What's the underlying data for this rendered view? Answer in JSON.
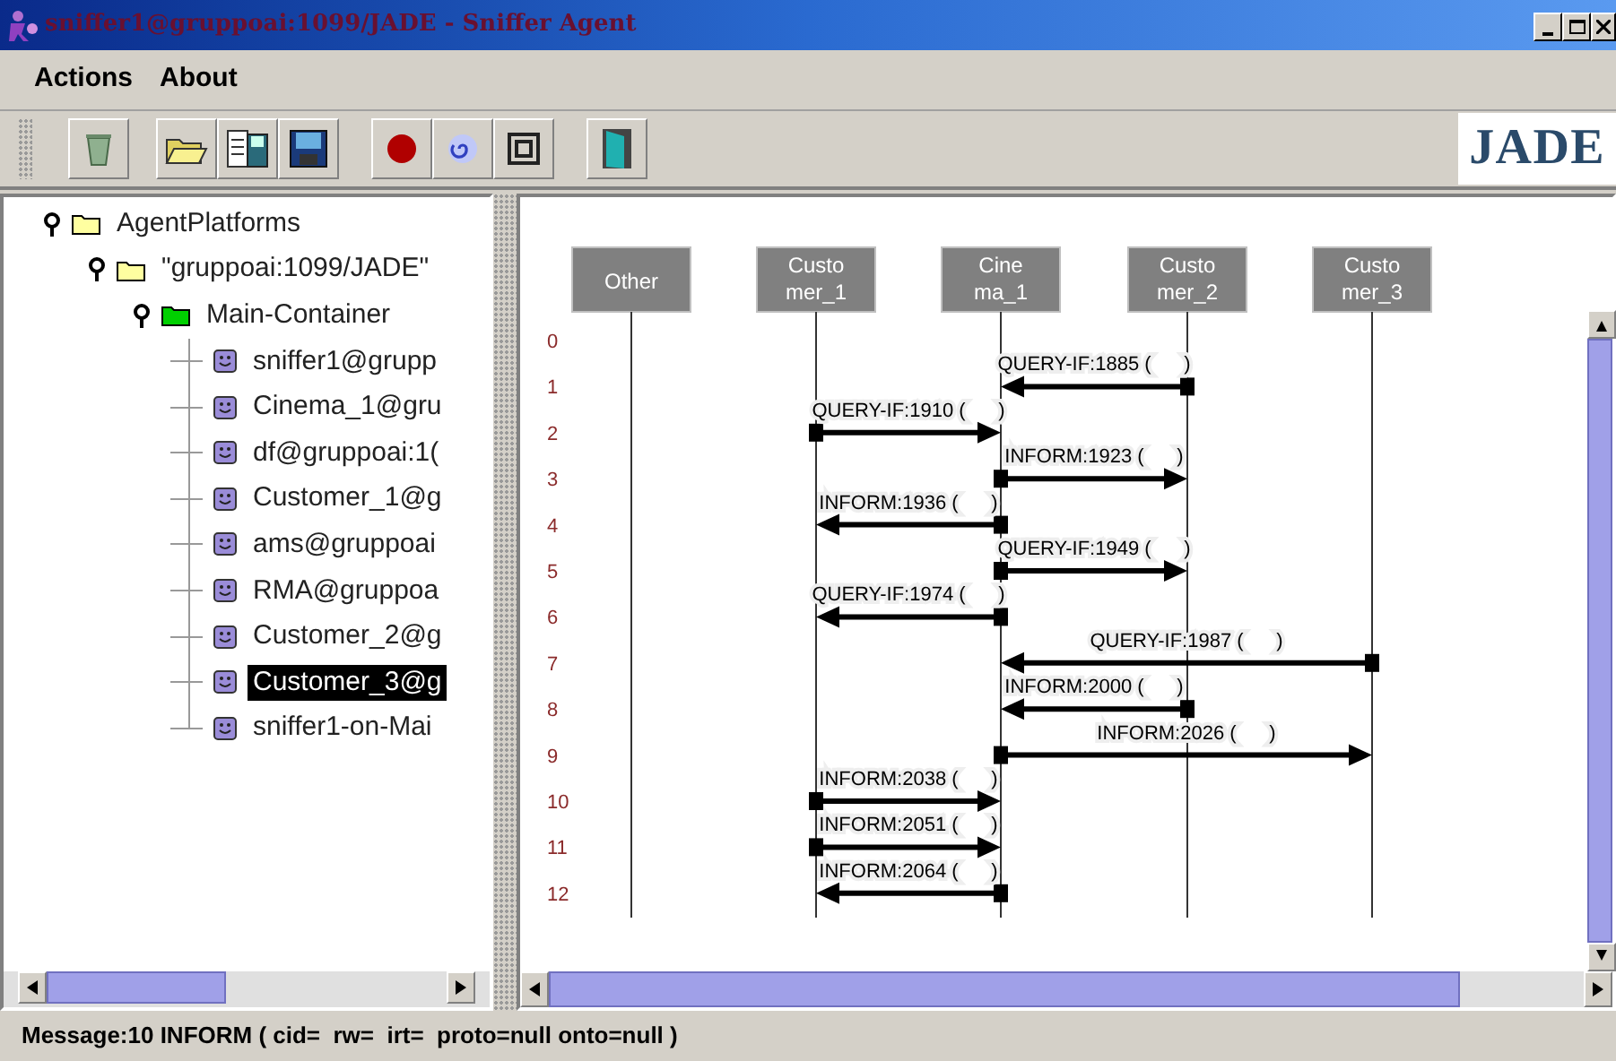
{
  "window": {
    "title": "sniffer1@gruppoai:1099/JADE - Sniffer Agent"
  },
  "menu": [
    {
      "label": "Actions"
    },
    {
      "label": "About"
    }
  ],
  "toolbar": {
    "logo": "JADE"
  },
  "tree": [
    {
      "label": "AgentPlatforms",
      "kind": "folder",
      "expanded": true,
      "children": [
        {
          "label": "\"gruppoai:1099/JADE\"",
          "kind": "folder",
          "expanded": true,
          "children": [
            {
              "label": "Main-Container",
              "kind": "container",
              "expanded": true,
              "children": [
                {
                  "label": "sniffer1@grupp",
                  "kind": "agent",
                  "selected": false
                },
                {
                  "label": "Cinema_1@gru",
                  "kind": "agent",
                  "selected": false
                },
                {
                  "label": "df@gruppoai:1(",
                  "kind": "agent",
                  "selected": false
                },
                {
                  "label": "Customer_1@g",
                  "kind": "agent",
                  "selected": false
                },
                {
                  "label": "ams@gruppoai",
                  "kind": "agent",
                  "selected": false
                },
                {
                  "label": "RMA@gruppoa",
                  "kind": "agent",
                  "selected": false
                },
                {
                  "label": "Customer_2@g",
                  "kind": "agent",
                  "selected": false
                },
                {
                  "label": "Customer_3@g",
                  "kind": "agent",
                  "selected": true
                },
                {
                  "label": "sniffer1-on-Mai",
                  "kind": "agent",
                  "selected": false
                }
              ]
            }
          ]
        }
      ]
    }
  ],
  "diagram": {
    "agents": [
      {
        "lines": [
          "Other"
        ]
      },
      {
        "lines": [
          "Custo",
          "mer_1"
        ]
      },
      {
        "lines": [
          "Cine",
          "ma_1"
        ]
      },
      {
        "lines": [
          "Custo",
          "mer_2"
        ]
      },
      {
        "lines": [
          "Custo",
          "mer_3"
        ]
      }
    ],
    "rows": [
      "0",
      "1",
      "2",
      "3",
      "4",
      "5",
      "6",
      "7",
      "8",
      "9",
      "10",
      "11",
      "12"
    ],
    "messages": [
      {
        "label": "QUERY-IF:1885 (      )",
        "lanes": [
          {
            "sends": false,
            "receives": false
          },
          {
            "sends": false,
            "receives": false
          },
          {
            "sends": false,
            "receives": true
          },
          {
            "sends": true,
            "receives": false
          },
          {
            "sends": false,
            "receives": false
          }
        ]
      },
      {
        "label": "QUERY-IF:1910 (      )",
        "lanes": [
          {
            "sends": false,
            "receives": false
          },
          {
            "sends": true,
            "receives": false
          },
          {
            "sends": false,
            "receives": true
          },
          {
            "sends": false,
            "receives": false
          },
          {
            "sends": false,
            "receives": false
          }
        ]
      },
      {
        "label": "INFORM:1923 (      )",
        "lanes": [
          {
            "sends": false,
            "receives": false
          },
          {
            "sends": false,
            "receives": false
          },
          {
            "sends": true,
            "receives": false
          },
          {
            "sends": false,
            "receives": true
          },
          {
            "sends": false,
            "receives": false
          }
        ]
      },
      {
        "label": "INFORM:1936 (      )",
        "lanes": [
          {
            "sends": false,
            "receives": false
          },
          {
            "sends": false,
            "receives": true
          },
          {
            "sends": true,
            "receives": false
          },
          {
            "sends": false,
            "receives": false
          },
          {
            "sends": false,
            "receives": false
          }
        ]
      },
      {
        "label": "QUERY-IF:1949 (      )",
        "lanes": [
          {
            "sends": false,
            "receives": false
          },
          {
            "sends": false,
            "receives": false
          },
          {
            "sends": true,
            "receives": false
          },
          {
            "sends": false,
            "receives": true
          },
          {
            "sends": false,
            "receives": false
          }
        ]
      },
      {
        "label": "QUERY-IF:1974 (      )",
        "lanes": [
          {
            "sends": false,
            "receives": false
          },
          {
            "sends": false,
            "receives": true
          },
          {
            "sends": true,
            "receives": false
          },
          {
            "sends": false,
            "receives": false
          },
          {
            "sends": false,
            "receives": false
          }
        ]
      },
      {
        "label": "QUERY-IF:1987 (      )",
        "lanes": [
          {
            "sends": false,
            "receives": false
          },
          {
            "sends": false,
            "receives": false
          },
          {
            "sends": false,
            "receives": true
          },
          {
            "sends": false,
            "receives": false
          },
          {
            "sends": true,
            "receives": false
          }
        ]
      },
      {
        "label": "INFORM:2000 (      )",
        "lanes": [
          {
            "sends": false,
            "receives": false
          },
          {
            "sends": false,
            "receives": false
          },
          {
            "sends": false,
            "receives": true
          },
          {
            "sends": true,
            "receives": false
          },
          {
            "sends": false,
            "receives": false
          }
        ]
      },
      {
        "label": "INFORM:2026 (      )",
        "lanes": [
          {
            "sends": false,
            "receives": false
          },
          {
            "sends": false,
            "receives": false
          },
          {
            "sends": true,
            "receives": false
          },
          {
            "sends": false,
            "receives": false
          },
          {
            "sends": false,
            "receives": true
          }
        ]
      },
      {
        "label": "INFORM:2038 (      )",
        "lanes": [
          {
            "sends": false,
            "receives": false
          },
          {
            "sends": true,
            "receives": false
          },
          {
            "sends": false,
            "receives": true
          },
          {
            "sends": false,
            "receives": false
          },
          {
            "sends": false,
            "receives": false
          }
        ]
      },
      {
        "label": "INFORM:2051 (      )",
        "lanes": [
          {
            "sends": false,
            "receives": false
          },
          {
            "sends": true,
            "receives": false
          },
          {
            "sends": false,
            "receives": true
          },
          {
            "sends": false,
            "receives": false
          },
          {
            "sends": false,
            "receives": false
          }
        ]
      },
      {
        "label": "INFORM:2064 (      )",
        "lanes": [
          {
            "sends": false,
            "receives": false
          },
          {
            "sends": false,
            "receives": true
          },
          {
            "sends": true,
            "receives": false
          },
          {
            "sends": false,
            "receives": false
          },
          {
            "sends": false,
            "receives": false
          }
        ]
      }
    ]
  },
  "status_bar": "Message:10 INFORM ( cid=  rw=  irt=  proto=null onto=null )"
}
